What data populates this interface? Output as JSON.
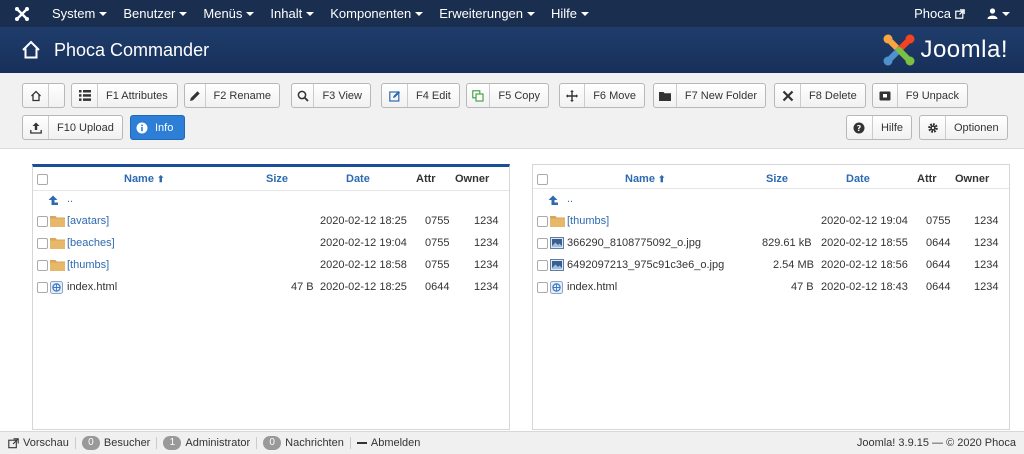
{
  "topnav": {
    "menu": [
      {
        "label": "System"
      },
      {
        "label": "Benutzer"
      },
      {
        "label": "Menüs"
      },
      {
        "label": "Inhalt"
      },
      {
        "label": "Komponenten"
      },
      {
        "label": "Erweiterungen"
      },
      {
        "label": "Hilfe"
      }
    ],
    "site_link": "Phoca",
    "user_icon": "user-icon"
  },
  "header": {
    "title": "Phoca Commander",
    "brand": "Joomla!"
  },
  "toolbar": {
    "buttons": [
      {
        "label": "",
        "icon": "home-icon"
      },
      {
        "label": "F1 Attributes",
        "icon": "list-icon"
      },
      {
        "label": "F2 Rename",
        "icon": "pencil-icon"
      },
      {
        "label": "F3 View",
        "icon": "search-icon"
      },
      {
        "label": "F4 Edit",
        "icon": "edit-icon"
      },
      {
        "label": "F5 Copy",
        "icon": "copy-icon"
      },
      {
        "label": "F6 Move",
        "icon": "move-icon"
      },
      {
        "label": "F7 New Folder",
        "icon": "folder-icon"
      },
      {
        "label": "F8 Delete",
        "icon": "delete-icon"
      },
      {
        "label": "F9 Unpack",
        "icon": "unpack-icon"
      },
      {
        "label": "F10 Upload",
        "icon": "upload-icon"
      },
      {
        "label": "Info",
        "icon": "info-icon"
      }
    ],
    "help_label": "Hilfe",
    "options_label": "Optionen"
  },
  "columns": {
    "name": "Name",
    "size": "Size",
    "date": "Date",
    "attr": "Attr",
    "owner": "Owner",
    "up": ".."
  },
  "left_panel": {
    "rows": [
      {
        "name": "[avatars]",
        "size": "",
        "date": "2020-02-12 18:25",
        "attr": "0755",
        "owner": "1234",
        "type": "folder"
      },
      {
        "name": "[beaches]",
        "size": "",
        "date": "2020-02-12 19:04",
        "attr": "0755",
        "owner": "1234",
        "type": "folder"
      },
      {
        "name": "[thumbs]",
        "size": "",
        "date": "2020-02-12 18:58",
        "attr": "0755",
        "owner": "1234",
        "type": "folder"
      },
      {
        "name": "index.html",
        "size": "47 B",
        "date": "2020-02-12 18:25",
        "attr": "0644",
        "owner": "1234",
        "type": "html"
      }
    ]
  },
  "right_panel": {
    "rows": [
      {
        "name": "[thumbs]",
        "size": "",
        "date": "2020-02-12 19:04",
        "attr": "0755",
        "owner": "1234",
        "type": "folder"
      },
      {
        "name": "366290_8108775092_o.jpg",
        "size": "829.61 kB",
        "date": "2020-02-12 18:55",
        "attr": "0644",
        "owner": "1234",
        "type": "image"
      },
      {
        "name": "6492097213_975c91c3e6_o.jpg",
        "size": "2.54 MB",
        "date": "2020-02-12 18:56",
        "attr": "0644",
        "owner": "1234",
        "type": "image"
      },
      {
        "name": "index.html",
        "size": "47 B",
        "date": "2020-02-12 18:43",
        "attr": "0644",
        "owner": "1234",
        "type": "html"
      }
    ]
  },
  "footer": {
    "preview": "Vorschau",
    "visitors_count": "0",
    "visitors_label": "Besucher",
    "admin_count": "1",
    "admin_label": "Administrator",
    "messages_count": "0",
    "messages_label": "Nachrichten",
    "logout": "Abmelden",
    "version": "Joomla! 3.9.15  —  © 2020 Phoca"
  },
  "colors": {
    "nav_bg": "#1a2e4f",
    "header_bg": "#1f3c6b",
    "info_button": "#2d7ed6",
    "link": "#2e6ab0"
  }
}
